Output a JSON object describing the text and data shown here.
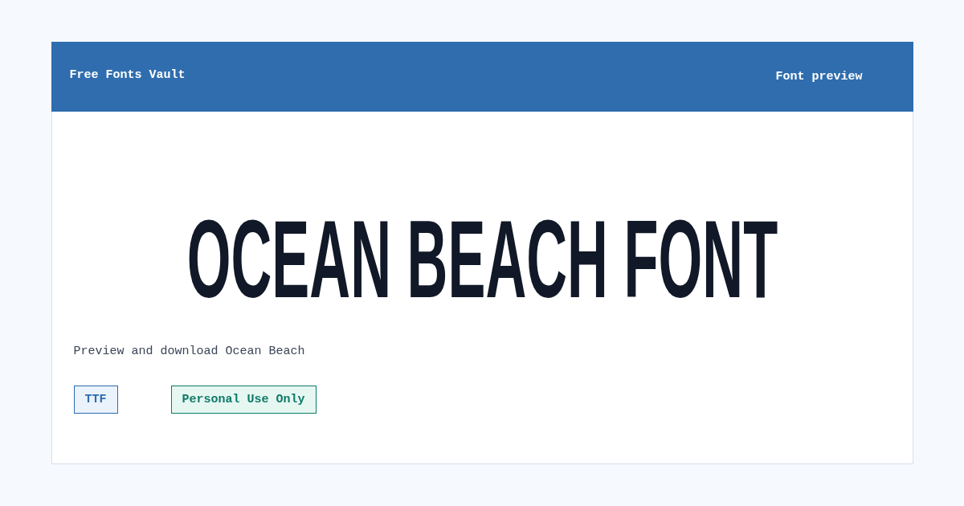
{
  "header": {
    "site_name": "Free Fonts Vault",
    "page_label": "Font preview"
  },
  "preview": {
    "title": "OCEAN BEACH FONT",
    "description": "Preview and download Ocean Beach"
  },
  "tags": [
    {
      "label": "TTF",
      "kind": "format"
    },
    {
      "label": "Personal Use Only",
      "kind": "license"
    }
  ]
}
